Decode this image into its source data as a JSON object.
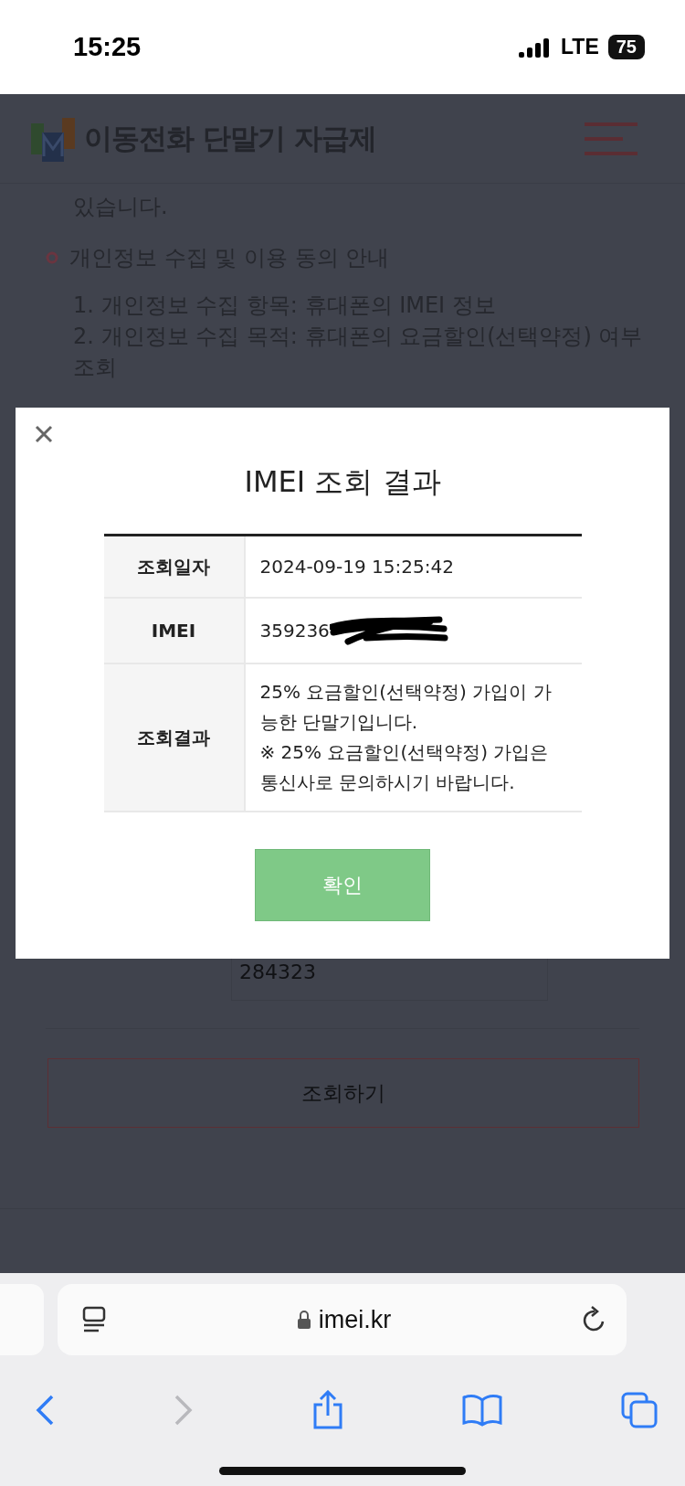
{
  "status_bar": {
    "time": "15:25",
    "network": "LTE",
    "battery": "75"
  },
  "site": {
    "logo_text": "이동전화 단말기 자급제",
    "paragraph_tail": "있습니다.",
    "section_heading": "개인정보 수집 및 이용 동의 안내",
    "items": [
      "1. 개인정보 수집 항목: 휴대폰의 IMEI 정보",
      "2. 개인정보 수집 목적: 휴대폰의 요금할인(선택약정) 여부 조회"
    ],
    "code_field": {
      "value": "284323"
    },
    "submit": "조회하기"
  },
  "modal": {
    "title": "IMEI 조회 결과",
    "rows": [
      {
        "label": "조회일자",
        "lines": [
          "2024-09-19 15:25:42"
        ],
        "redacted": false
      },
      {
        "label": "IMEI",
        "lines": [
          "359236"
        ],
        "redacted": true
      },
      {
        "label": "조회결과",
        "lines": [
          "25% 요금할인(선택약정) 가입이 가능한 단말기입니다.",
          "※ 25% 요금할인(선택약정) 가입은 통신사로 문의하시기 바랍니다."
        ],
        "redacted": false
      }
    ],
    "confirm": "확인"
  },
  "browser": {
    "url": "imei.kr",
    "forward_disabled": true
  }
}
